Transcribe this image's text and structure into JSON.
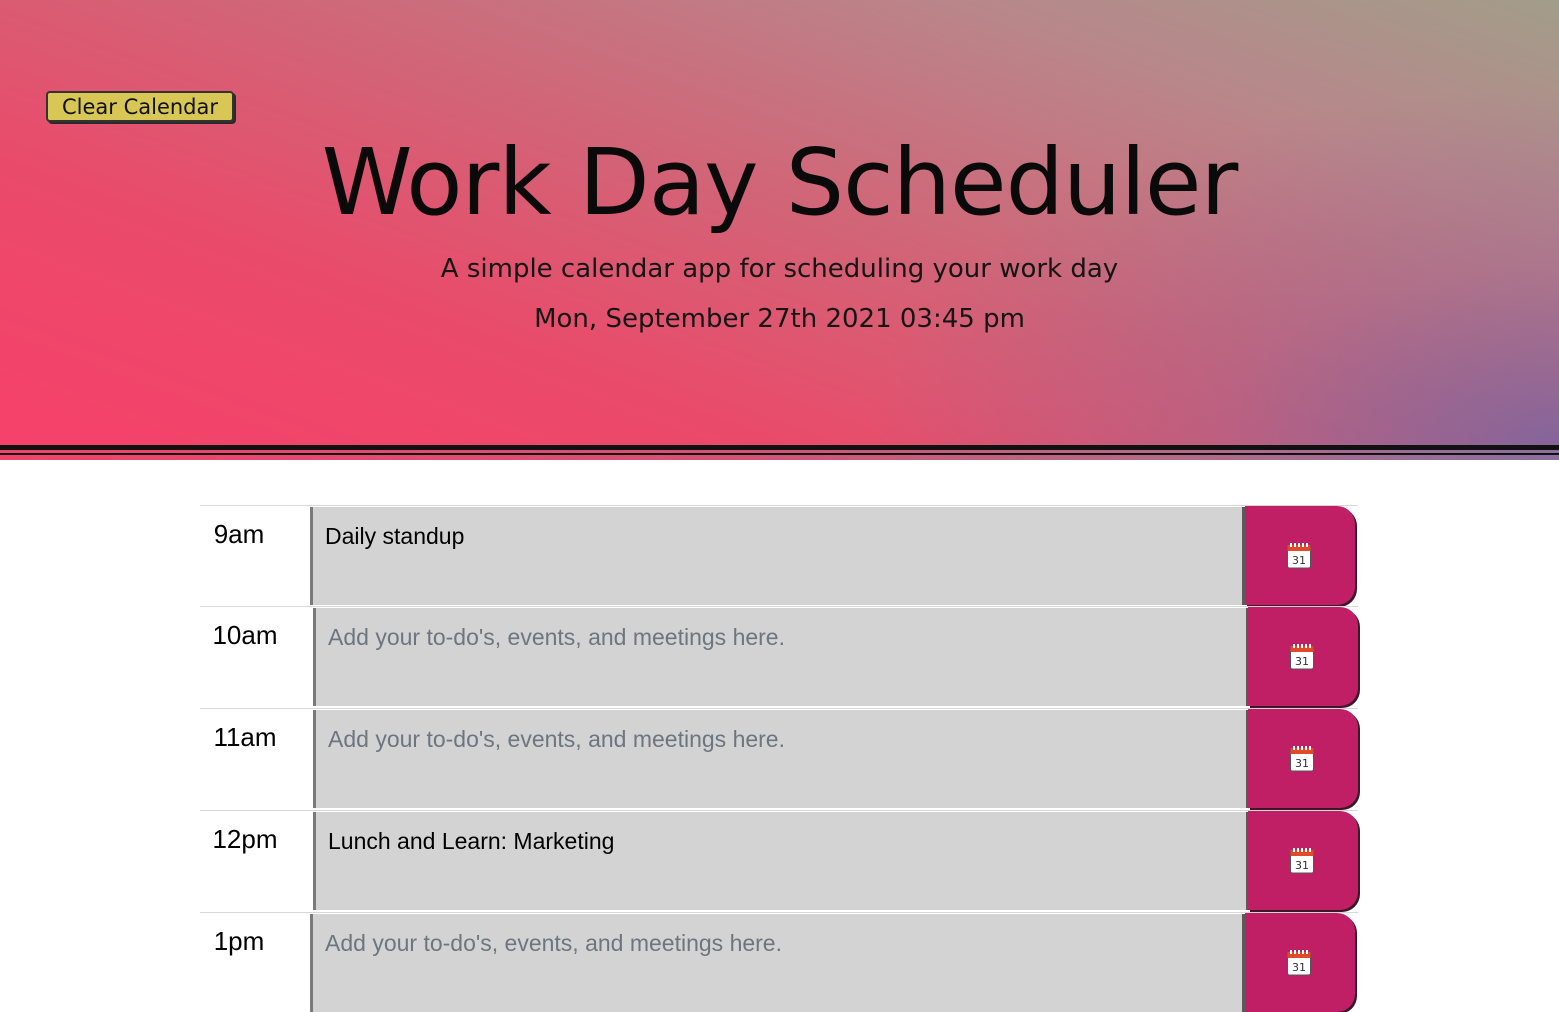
{
  "header": {
    "clear_button_label": "Clear Calendar",
    "title": "Work Day Scheduler",
    "subtitle": "A simple calendar app for scheduling your work day",
    "current_date": "Mon, September 27th 2021 03:45 pm"
  },
  "placeholder": "Add your to-do's, events, and meetings here.",
  "save_icon": "calendar-31-icon",
  "colors": {
    "save_button": "#c01f66",
    "text_area": "#d3d3d3",
    "clear_button": "#d8c655"
  },
  "hours": [
    {
      "label": "9am",
      "value": "Daily standup"
    },
    {
      "label": "10am",
      "value": ""
    },
    {
      "label": "11am",
      "value": ""
    },
    {
      "label": "12pm",
      "value": "Lunch and Learn: Marketing"
    },
    {
      "label": "1pm",
      "value": ""
    }
  ]
}
